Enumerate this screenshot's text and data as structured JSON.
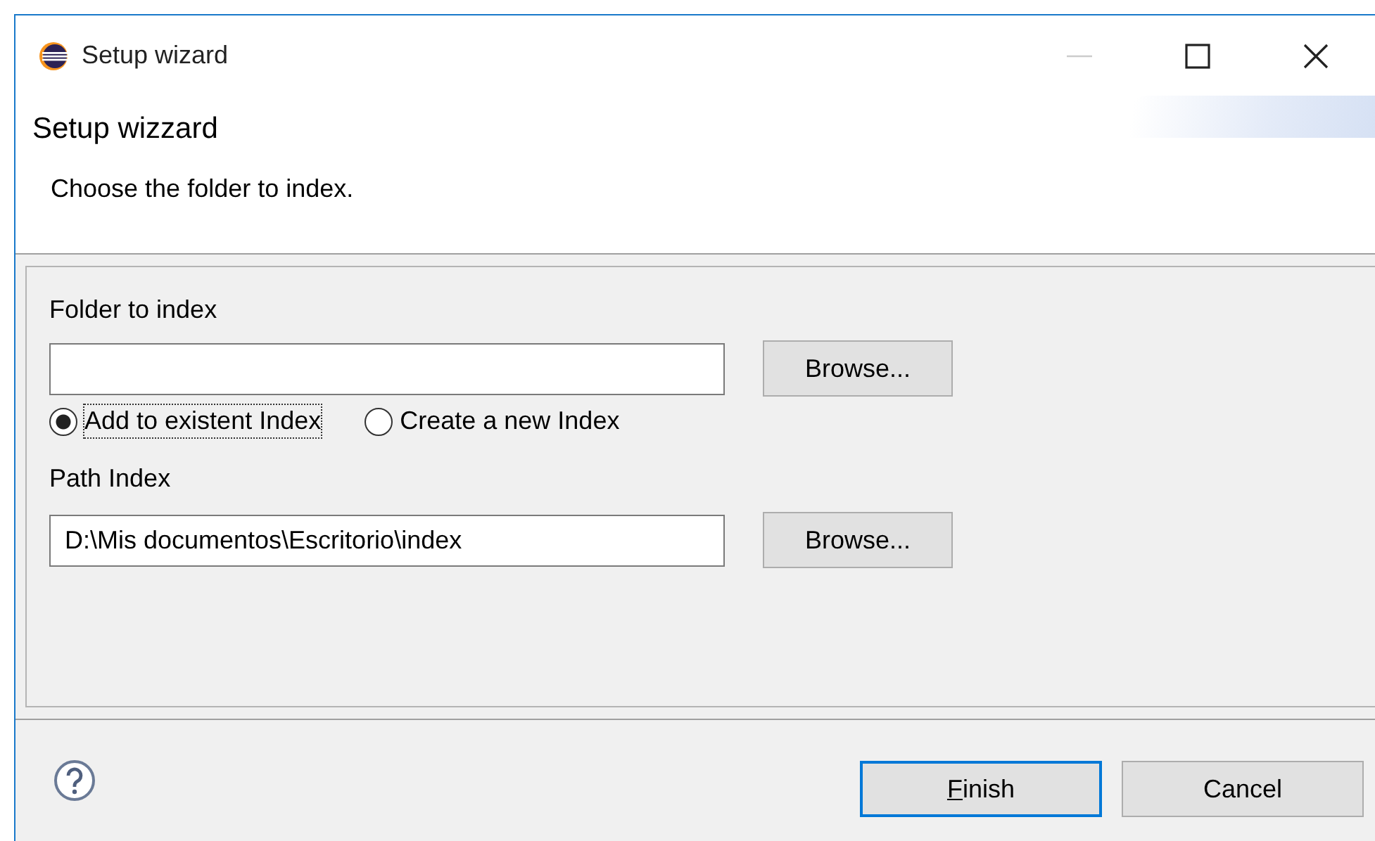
{
  "window": {
    "title": "Setup wizard",
    "controls": [
      {
        "kind": "minimize",
        "disabled": true
      },
      {
        "kind": "maximize",
        "disabled": false
      },
      {
        "kind": "close",
        "disabled": false
      }
    ]
  },
  "header": {
    "title": "Setup wizzard",
    "message": "Choose the folder to index."
  },
  "form": {
    "folder_label": "Folder to index",
    "folder_browse": "Browse...",
    "radios": [
      {
        "label": "Add to existent Index",
        "selected": true,
        "focused": true
      },
      {
        "label": "Create a new Index",
        "selected": false,
        "focused": false
      }
    ],
    "path_label": "Path Index",
    "path_value": "D:\\Mis documentos\\Escritorio\\index",
    "path_browse": "Browse..."
  },
  "buttons": [
    {
      "label": "Finish",
      "default": true,
      "underline_first": true
    },
    {
      "label": "Cancel",
      "default": false,
      "underline_first": false
    }
  ]
}
